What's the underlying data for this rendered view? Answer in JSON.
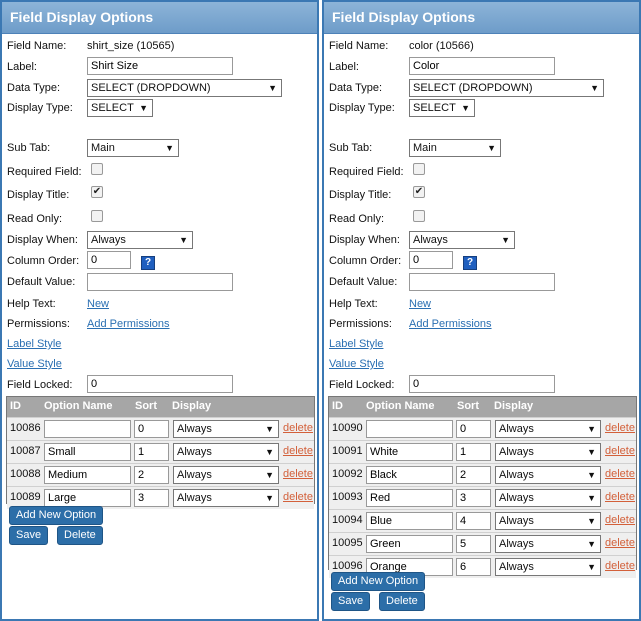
{
  "labels": {
    "field_name": "Field Name:",
    "label": "Label:",
    "data_type": "Data Type:",
    "display_type": "Display Type:",
    "sub_tab": "Sub Tab:",
    "required_field": "Required Field:",
    "display_title": "Display Title:",
    "read_only": "Read Only:",
    "display_when": "Display When:",
    "column_order": "Column Order:",
    "default_value": "Default Value:",
    "help_text": "Help Text:",
    "permissions": "Permissions:",
    "label_style": "Label Style",
    "value_style": "Value Style",
    "field_locked": "Field Locked:",
    "new_link": "New",
    "add_permissions": "Add Permissions",
    "help_icon": "?"
  },
  "table_headers": {
    "id": "ID",
    "option_name": "Option Name",
    "sort": "Sort",
    "display": "Display"
  },
  "buttons": {
    "add_new_option": "Add New Option",
    "save": "Save",
    "delete": "Delete",
    "delete_row": "delete"
  },
  "left": {
    "title": "Field Display Options",
    "field_name": "shirt_size (10565)",
    "label": "Shirt Size",
    "data_type": "SELECT (DROPDOWN)",
    "display_type": "SELECT",
    "sub_tab": "Main",
    "required": false,
    "display_title": true,
    "read_only": false,
    "display_when": "Always",
    "column_order": "0",
    "default_value": "",
    "field_locked": "0",
    "options": [
      {
        "id": "10086",
        "name": "",
        "sort": "0",
        "display": "Always"
      },
      {
        "id": "10087",
        "name": "Small",
        "sort": "1",
        "display": "Always"
      },
      {
        "id": "10088",
        "name": "Medium",
        "sort": "2",
        "display": "Always"
      },
      {
        "id": "10089",
        "name": "Large",
        "sort": "3",
        "display": "Always"
      }
    ]
  },
  "right": {
    "title": "Field Display Options",
    "field_name": "color (10566)",
    "label": "Color",
    "data_type": "SELECT (DROPDOWN)",
    "display_type": "SELECT",
    "sub_tab": "Main",
    "required": false,
    "display_title": true,
    "read_only": false,
    "display_when": "Always",
    "column_order": "0",
    "default_value": "",
    "field_locked": "0",
    "options": [
      {
        "id": "10090",
        "name": "",
        "sort": "0",
        "display": "Always"
      },
      {
        "id": "10091",
        "name": "White",
        "sort": "1",
        "display": "Always"
      },
      {
        "id": "10092",
        "name": "Black",
        "sort": "2",
        "display": "Always"
      },
      {
        "id": "10093",
        "name": "Red",
        "sort": "3",
        "display": "Always"
      },
      {
        "id": "10094",
        "name": "Blue",
        "sort": "4",
        "display": "Always"
      },
      {
        "id": "10095",
        "name": "Green",
        "sort": "5",
        "display": "Always"
      },
      {
        "id": "10096",
        "name": "Orange",
        "sort": "6",
        "display": "Always"
      }
    ]
  },
  "colors": {
    "header": "#7aa6d1",
    "link": "#2a6fb2",
    "delete_link": "#d3603a",
    "button": "#2c6ea8"
  }
}
